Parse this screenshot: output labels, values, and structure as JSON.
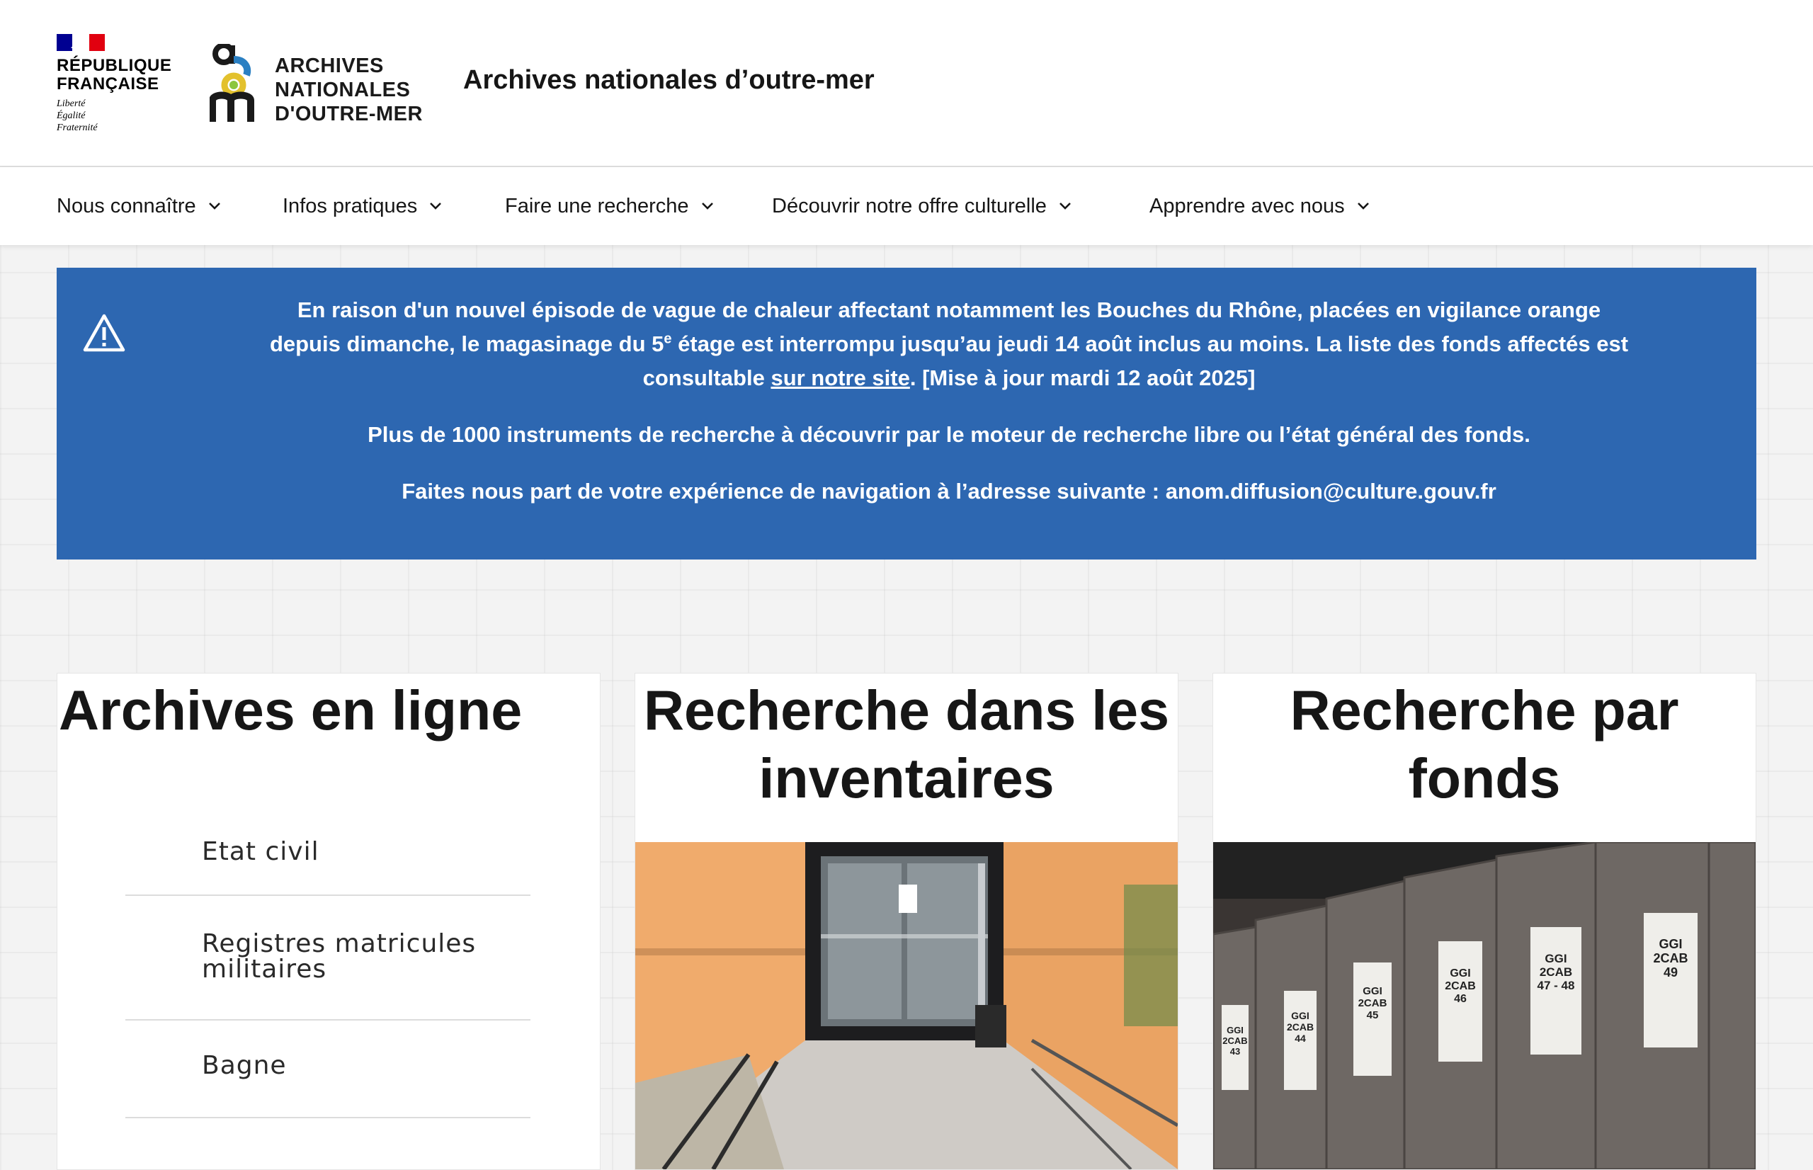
{
  "header": {
    "republique": [
      "RÉPUBLIQUE",
      "FRANÇAISE"
    ],
    "motto": [
      "Liberté",
      "Égalité",
      "Fraternité"
    ],
    "anom_logo_lines": [
      "ARCHIVES",
      "NATIONALES",
      "D'OUTRE-MER"
    ],
    "site_title": "Archives nationales d’outre-mer"
  },
  "nav": [
    {
      "label": "Nous connaître",
      "icon": "chevron-down-icon"
    },
    {
      "label": "Infos pratiques",
      "icon": "chevron-down-icon"
    },
    {
      "label": "Faire une recherche",
      "icon": "chevron-down-icon"
    },
    {
      "label": "Découvrir notre offre culturelle",
      "icon": "chevron-down-icon"
    },
    {
      "label": "Apprendre avec nous",
      "icon": "chevron-down-icon"
    }
  ],
  "banner": {
    "icon": "warning-icon",
    "color": "#2d67b1",
    "p1_part1": "En raison d'un nouvel épisode de vague de chaleur affectant notamment les Bouches du Rhône, placées en vigilance orange",
    "p1_part2_before": "depuis dimanche, le magasinage du 5",
    "p1_sup": "e",
    "p1_part2_after": " étage est interrompu jusqu’au jeudi 14 août inclus au moins. La liste des fonds affectés est",
    "p1_part3_before": "consultable ",
    "p1_link": "sur notre site",
    "p1_part3_after": ". [Mise à jour mardi 12 août 2025]",
    "p2": "Plus de 1000 instruments de recherche à découvrir par le moteur de recherche libre ou l’état général des fonds.",
    "p3": "Faites nous part de votre expérience de navigation à l’adresse suivante : anom.diffusion@culture.gouv.fr"
  },
  "cards": {
    "archives": {
      "title": "Archives en ligne",
      "items": [
        "Etat civil",
        "Registres matricules militaires",
        "Bagne"
      ]
    },
    "inventaires": {
      "title": "Recherche dans les inventaires"
    },
    "fonds": {
      "title": "Recherche par fonds",
      "box_labels": [
        "GGI\n2CAB\n43",
        "GGI\n2CAB\n44",
        "GGI\n2CAB\n45",
        "GGI\n2CAB\n46",
        "GGI\n2CAB\n47 - 48",
        "GGI\n2CAB\n49"
      ]
    }
  }
}
